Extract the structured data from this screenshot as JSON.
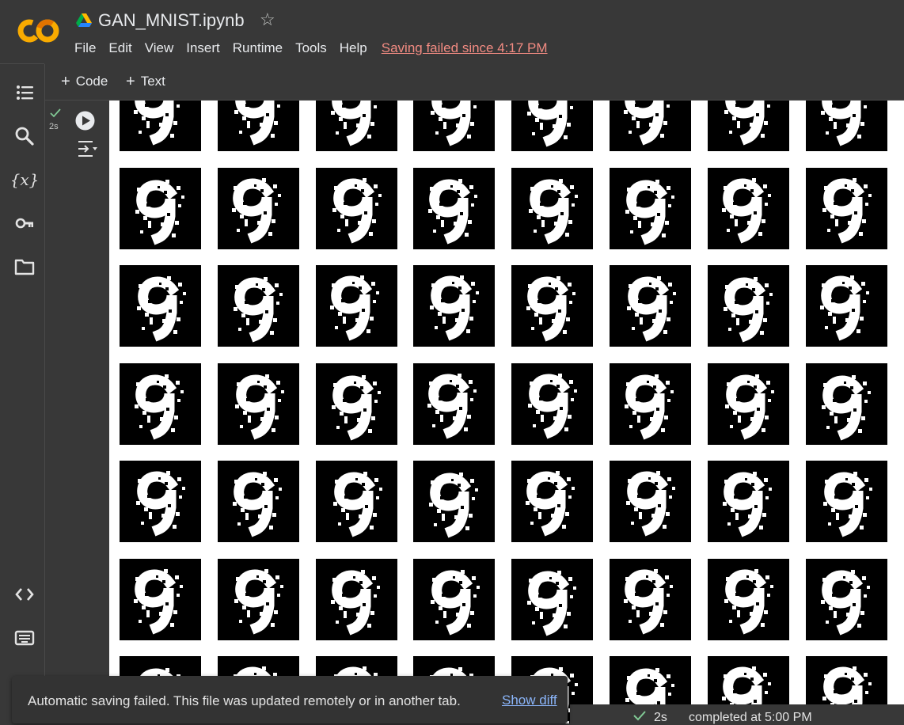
{
  "header": {
    "title": "GAN_MNIST.ipynb",
    "logo_text": "CO",
    "menu": [
      "File",
      "Edit",
      "View",
      "Insert",
      "Runtime",
      "Tools",
      "Help"
    ],
    "save_warning": "Saving failed since 4:17 PM"
  },
  "sidebar": {
    "items": [
      "table-of-contents-icon",
      "search-icon",
      "variables-icon",
      "secrets-key-icon",
      "files-folder-icon"
    ],
    "bottom_items": [
      "code-snippets-icon",
      "command-palette-icon"
    ],
    "variables_glyph": "{x}"
  },
  "toolbar": {
    "add_code": "Code",
    "add_text": "Text"
  },
  "cell": {
    "exec_time": "2s"
  },
  "output": {
    "grid_columns": 8,
    "visible_rows": 7,
    "image_content": "generated digit 9 (MNIST GAN sample)"
  },
  "snackbar": {
    "message": "Automatic saving failed. This file was updated remotely or in another tab.",
    "action": "Show diff"
  },
  "status": {
    "time": "2s",
    "completed": "completed at 5:00 PM"
  },
  "colors": {
    "warning": "#f28b82",
    "link": "#8ab4f8",
    "success": "#81c995",
    "logo_orange": "#f9ab00",
    "logo_dark": "#e37400"
  }
}
